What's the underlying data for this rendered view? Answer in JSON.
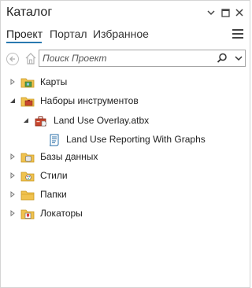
{
  "window": {
    "title": "Каталог"
  },
  "tabs": [
    {
      "label": "Проект",
      "active": true
    },
    {
      "label": "Портал",
      "active": false
    },
    {
      "label": "Избранное",
      "active": false
    }
  ],
  "search": {
    "placeholder": "Поиск Проект",
    "value": ""
  },
  "tree": [
    {
      "label": "Карты",
      "icon": "maps-folder-icon",
      "expanded": false,
      "level": 0
    },
    {
      "label": "Наборы инструментов",
      "icon": "toolboxes-folder-icon",
      "expanded": true,
      "level": 0
    },
    {
      "label": "Land Use Overlay.atbx",
      "icon": "toolbox-icon",
      "expanded": true,
      "level": 1
    },
    {
      "label": "Land Use Reporting With Graphs",
      "icon": "script-tool-icon",
      "expanded": null,
      "level": 2
    },
    {
      "label": "Базы данных",
      "icon": "databases-folder-icon",
      "expanded": false,
      "level": 0
    },
    {
      "label": "Стили",
      "icon": "styles-folder-icon",
      "expanded": false,
      "level": 0
    },
    {
      "label": "Папки",
      "icon": "folders-icon",
      "expanded": false,
      "level": 0
    },
    {
      "label": "Локаторы",
      "icon": "locators-folder-icon",
      "expanded": false,
      "level": 0
    }
  ],
  "colors": {
    "accent": "#2a7ab0",
    "folder": "#f0c24f",
    "folder_dark": "#d9a52a"
  }
}
